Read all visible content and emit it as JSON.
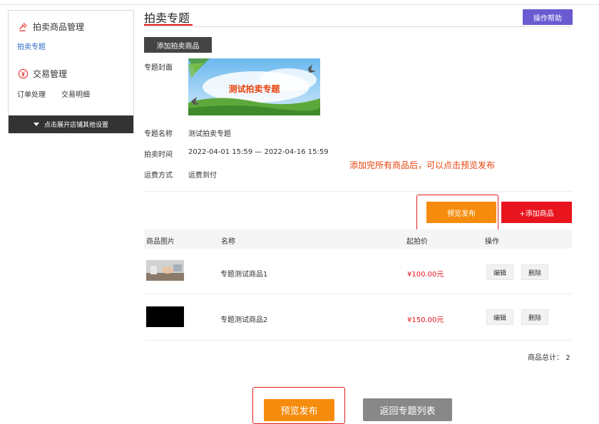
{
  "sidebar": {
    "section1_title": "拍卖商品管理",
    "section1_links": [
      "拍卖专题"
    ],
    "section2_title": "交易管理",
    "section2_links": [
      "订单处理",
      "交易明细"
    ],
    "expand_label": "点击展开店铺其他设置"
  },
  "header": {
    "title": "拍卖专题",
    "help_label": "操作帮助"
  },
  "toolbar": {
    "add_auction_label": "添加拍卖商品"
  },
  "info": {
    "cover_label": "专题封面",
    "cover_text": "测试拍卖专题",
    "name_label": "专题名称",
    "name_value": "测试拍卖专题",
    "time_label": "拍卖时间",
    "time_value": "2022-04-01 15:59 — 2022-04-16 15:59",
    "ship_label": "运费方式",
    "ship_value": "运费到付"
  },
  "annotation": "添加完所有商品后，可以点击预览发布",
  "actions": {
    "preview_label": "预览发布",
    "add_goods_label": "+添加商品"
  },
  "table": {
    "headers": [
      "商品图片",
      "名称",
      "起拍价",
      "操作"
    ],
    "rows": [
      {
        "name": "专题测试商品1",
        "price": "¥100.00元",
        "edit": "编辑",
        "delete": "删除"
      },
      {
        "name": "专题测试商品2",
        "price": "¥150.00元",
        "edit": "编辑",
        "delete": "删除"
      }
    ]
  },
  "summary": {
    "total_label": "商品总计：",
    "total_value": "2"
  },
  "footer": {
    "preview_label": "预览发布",
    "back_label": "返回专题列表"
  },
  "colors": {
    "accent_red": "#e8141e",
    "orange": "#f68c0d",
    "help_purple": "#6a5bd1",
    "link_blue": "#2e6ac6"
  }
}
